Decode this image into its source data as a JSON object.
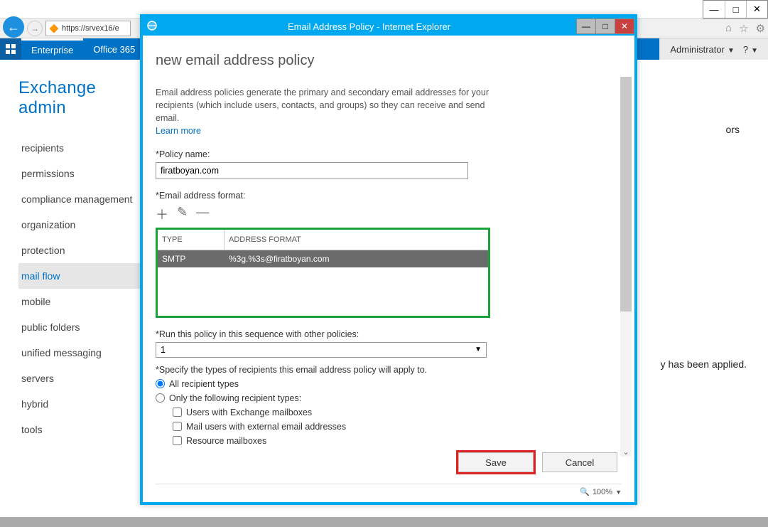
{
  "os": {
    "min": "—",
    "max": "□",
    "close": "✕"
  },
  "browser": {
    "url": "https://srvex16/e",
    "rightIcons": [
      "⌂",
      "☆",
      "⚙"
    ]
  },
  "eac": {
    "tabs": {
      "enterprise": "Enterprise",
      "office365": "Office 365"
    },
    "user": "Administrator",
    "help": "?",
    "title": "Exchange admin",
    "nav": [
      "recipients",
      "permissions",
      "compliance management",
      "organization",
      "protection",
      "mail flow",
      "mobile",
      "public folders",
      "unified messaging",
      "servers",
      "hybrid",
      "tools"
    ],
    "navSelectedIndex": 5,
    "bgRight1": "ors",
    "bgRight2": "y has been applied."
  },
  "modal": {
    "title": "Email Address Policy - Internet Explorer",
    "heading": "new email address policy",
    "desc1": "Email address policies generate the primary and secondary email addresses for your recipients (which include users, contacts, and groups) so they can receive and send email.",
    "learn": "Learn more",
    "policyLabel": "*Policy name:",
    "policyValue": "firatboyan.com",
    "fmtLabel": "*Email address format:",
    "toolbar": {
      "add": "＋",
      "edit": "✎",
      "del": "—"
    },
    "colType": "TYPE",
    "colFmt": "ADDRESS FORMAT",
    "rowType": "SMTP",
    "rowFmt": "%3g.%3s@firatboyan.com",
    "seqLabel": "*Run this policy in this sequence with other policies:",
    "seqValue": "1",
    "applyLabel": "*Specify the types of recipients this email address policy will apply to.",
    "radioAll": "All recipient types",
    "radioOnly": "Only the following recipient types:",
    "chk1": "Users with Exchange mailboxes",
    "chk2": "Mail users with external email addresses",
    "chk3": "Resource mailboxes",
    "save": "Save",
    "cancel": "Cancel",
    "zoom": "100%"
  }
}
